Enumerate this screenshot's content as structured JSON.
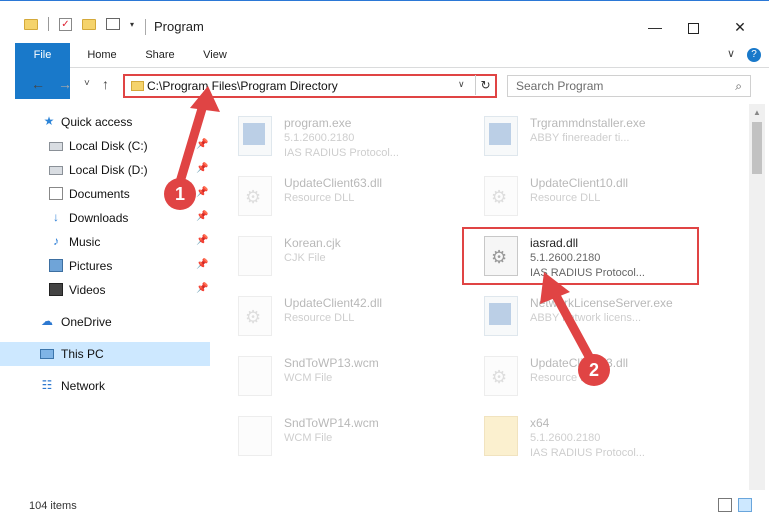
{
  "window": {
    "title": "Program",
    "min_glyph": "—",
    "close_glyph": "✕"
  },
  "qat": {
    "dropdown_glyph": "▾"
  },
  "ribbon": {
    "tabs": [
      "File",
      "Home",
      "Share",
      "View"
    ],
    "collapse_glyph": "∨",
    "help_glyph": "?"
  },
  "nav": {
    "back_glyph": "←",
    "forward_glyph": "→",
    "recent_glyph": "˅",
    "up_glyph": "↑",
    "address_path": "C:\\Program Files\\Program Directory",
    "address_dropdown_glyph": "∨",
    "refresh_glyph": "↻",
    "search_placeholder": "Search Program",
    "search_glyph": "⌕"
  },
  "sidebar": {
    "items": [
      {
        "label": "Quick access",
        "icon": "star-icon",
        "glyph": "★"
      },
      {
        "label": "Local Disk (C:)",
        "icon": "drive-icon",
        "glyph": ""
      },
      {
        "label": "Local Disk (D:)",
        "icon": "drive-icon",
        "glyph": ""
      },
      {
        "label": "Documents",
        "icon": "documents-icon",
        "glyph": ""
      },
      {
        "label": "Downloads",
        "icon": "downloads-icon",
        "glyph": "↓"
      },
      {
        "label": "Music",
        "icon": "music-icon",
        "glyph": "♪"
      },
      {
        "label": "Pictures",
        "icon": "pictures-icon",
        "glyph": ""
      },
      {
        "label": "Videos",
        "icon": "videos-icon",
        "glyph": ""
      },
      {
        "label": "OneDrive",
        "icon": "onedrive-icon",
        "glyph": "☁"
      },
      {
        "label": "This PC",
        "icon": "this-pc-icon",
        "glyph": ""
      },
      {
        "label": "Network",
        "icon": "network-icon",
        "glyph": "☷"
      }
    ],
    "pin_glyph": "📌"
  },
  "files": [
    {
      "name": "program.exe",
      "line2": "5.1.2600.2180",
      "line3": "IAS RADIUS Protocol...",
      "icon": "exe-icon"
    },
    {
      "name": "Trgrammdnstaller.exe",
      "line2": "ABBY finereader ti...",
      "line3": "",
      "icon": "exe-icon"
    },
    {
      "name": "UpdateClient63.dll",
      "line2": "Resource DLL",
      "line3": "",
      "icon": "dll-icon"
    },
    {
      "name": "UpdateClient10.dll",
      "line2": "Resource DLL",
      "line3": "",
      "icon": "dll-icon"
    },
    {
      "name": "Korean.cjk",
      "line2": "CJK File",
      "line3": "",
      "icon": "file-icon"
    },
    {
      "name": "iasrad.dll",
      "line2": "5.1.2600.2180",
      "line3": "IAS RADIUS Protocol...",
      "icon": "dll-icon"
    },
    {
      "name": "UpdateClient42.dll",
      "line2": "Resource DLL",
      "line3": "",
      "icon": "dll-icon"
    },
    {
      "name": "NetworkLicenseServer.exe",
      "line2": "ABBY network licens...",
      "line3": "",
      "icon": "exe-icon"
    },
    {
      "name": "SndToWP13.wcm",
      "line2": "WCM File",
      "line3": "",
      "icon": "file-icon"
    },
    {
      "name": "UpdateClient53.dll",
      "line2": "Resource DLL",
      "line3": "",
      "icon": "dll-icon"
    },
    {
      "name": "SndToWP14.wcm",
      "line2": "WCM File",
      "line3": "",
      "icon": "file-icon"
    },
    {
      "name": "x64",
      "line2": "5.1.2600.2180",
      "line3": "IAS RADIUS Protocol...",
      "icon": "folder-icon"
    }
  ],
  "status": {
    "item_count": "104 items"
  },
  "annotations": {
    "step1": "1",
    "step2": "2"
  },
  "colors": {
    "accent": "#1979ca",
    "highlight_red": "#e04444",
    "selected_bg": "#cde8ff"
  }
}
